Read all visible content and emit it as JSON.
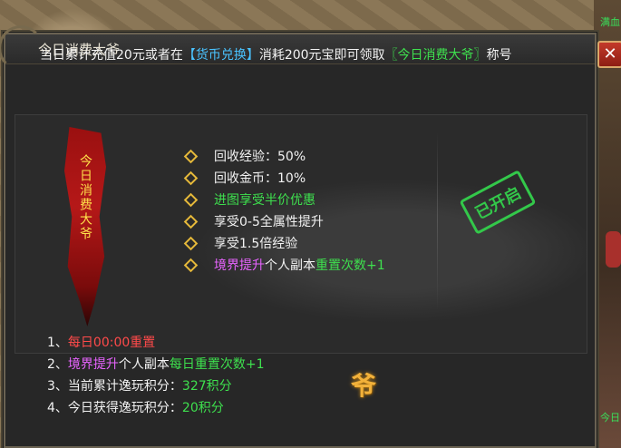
{
  "dialog": {
    "title": "今日消费大爷",
    "close_label": "✕",
    "info": {
      "prefix": "当日累计充值20元或者在",
      "exchange_link": "【货币兑换】",
      "middle": "消耗200元宝即可领取",
      "title_badge": "〖今日消费大爷〗",
      "suffix": "称号"
    },
    "banner_text": "今日消费大爷",
    "perks": [
      {
        "text": "回收经验：50%"
      },
      {
        "text": "回收金币：10%"
      },
      {
        "text": "进图享受半价优惠"
      },
      {
        "text": "享受0-5全属性提升"
      },
      {
        "text": "享受1.5倍经验"
      },
      {
        "part1": "境界提升",
        "part2": "个人副本",
        "part3": "重置次数+1"
      }
    ],
    "stamp": "已开启",
    "notes": [
      {
        "num": "1、",
        "text": "每日00:00重置"
      },
      {
        "num": "2、",
        "part1": "境界提升",
        "part2": "个人副本",
        "part3": "每日重置次数+1"
      },
      {
        "num": "3、",
        "label": "当前累计逸玩积分：",
        "value": "327积分"
      },
      {
        "num": "4、",
        "label": "今日获得逸玩积分：",
        "value": "20积分"
      }
    ],
    "ye_icon": "爷"
  },
  "world": {
    "label_top": "满血",
    "label_bottom": "今日"
  },
  "colors": {
    "link": "#4ac3ff",
    "highlight": "#3ee04e",
    "warning": "#ff4a4a",
    "special": "#e864ff",
    "stamp": "#33c84a"
  }
}
